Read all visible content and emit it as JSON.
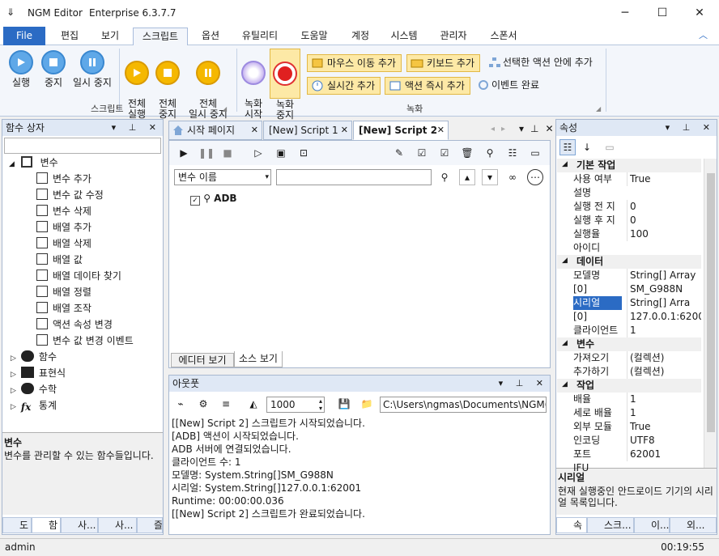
{
  "window": {
    "title": "NGM Editor",
    "edition": "Enterprise 6.3.7.7"
  },
  "menu": {
    "file": "File",
    "tabs": [
      "편집",
      "보기",
      "스크립트",
      "옵션",
      "유틸리티",
      "도움말",
      "계정",
      "시스템",
      "관리자",
      "스폰서"
    ],
    "active_tab": "스크립트"
  },
  "ribbon": {
    "script_group": {
      "label": "스크립트",
      "buttons": [
        {
          "label": "실행",
          "icon": "play-icon"
        },
        {
          "label": "중지",
          "icon": "stop-icon"
        },
        {
          "label": "일시 중지",
          "icon": "pause-icon"
        },
        {
          "label": "전체\n실행",
          "icon": "play-all-icon"
        },
        {
          "label": "전체\n중지",
          "icon": "stop-all-icon"
        },
        {
          "label": "전체\n일시 중지",
          "icon": "pause-all-icon"
        }
      ]
    },
    "record_group": {
      "label": "녹화",
      "record_start": "녹화\n시작",
      "record_stop": "녹화\n중지",
      "mouse_move": "마우스 이동 추가",
      "keyboard": "키보드 추가",
      "in_selected": "선택한 액션 안에 추가",
      "realtime": "실시간 추가",
      "action_now": "액션 즉시 추가",
      "event_done": "이벤트 완료"
    }
  },
  "function_box": {
    "title": "함수 상자",
    "search_placeholder": "",
    "tree": {
      "variables": "변수",
      "var_items": [
        "변수 추가",
        "변수 값 수정",
        "변수 삭제",
        "배열 추가",
        "배열 삭제",
        "배열 값",
        "배열 데이타 찾기",
        "배열 정렬",
        "배열 조작",
        "액션 속성 변경",
        "변수 값 변경 이벤트"
      ],
      "groups": [
        "함수",
        "표현식",
        "수학",
        "통계"
      ]
    },
    "desc_title": "변수",
    "desc_text": "변수를 관리할 수 있는 함수들입니다.",
    "bottom_tabs": [
      "도",
      "함",
      "사...",
      "사...",
      "즐"
    ]
  },
  "editor": {
    "tabs": [
      "시작 페이지",
      "[New] Script 1",
      "[New] Script 2"
    ],
    "active_tab": "[New] Script 2",
    "var_select": "변수 이름",
    "var_input": "",
    "node_label": "ADB",
    "view_tabs": [
      "에디터 보기",
      "소스 보기"
    ]
  },
  "output": {
    "title": "아웃풋",
    "count": "1000",
    "path": "C:\\Users\\ngmas\\Documents\\NGM6\\",
    "lines": [
      "[[New] Script 2] 스크립트가 시작되었습니다.",
      "[ADB] 액션이 시작되었습니다.",
      "ADB 서버에 연결되었습니다.",
      "클라이언트 수: 1",
      "모델명: System.String[]SM_G988N",
      "시리얼: System.String[]127.0.0.1:62001",
      "Runtime: 00:00:00.036",
      "[[New] Script 2] 스크립트가 완료되었습니다."
    ]
  },
  "properties": {
    "title": "속성",
    "categories": {
      "basic": "기본 작업",
      "data": "데이터",
      "vars": "변수",
      "work": "작업"
    },
    "basic_rows": [
      {
        "k": "사용 여부",
        "v": "True"
      },
      {
        "k": "설명",
        "v": ""
      },
      {
        "k": "실행 전 지",
        "v": "0"
      },
      {
        "k": "실행 후 지",
        "v": "0"
      },
      {
        "k": "실행율",
        "v": "100"
      },
      {
        "k": "아이디",
        "v": ""
      }
    ],
    "data_rows": [
      {
        "k": "모델명",
        "v": "String[] Array"
      },
      {
        "k": "[0]",
        "v": "SM_G988N"
      },
      {
        "k": "시리얼",
        "v": "String[] Arra"
      },
      {
        "k": "[0]",
        "v": "127.0.0.1:62001"
      },
      {
        "k": "클라이언트",
        "v": "1"
      }
    ],
    "var_rows": [
      {
        "k": "가져오기",
        "v": "(컬렉션)"
      },
      {
        "k": "추가하기",
        "v": "(컬렉션)"
      }
    ],
    "work_rows": [
      {
        "k": "배율",
        "v": "1"
      },
      {
        "k": "세로 배율",
        "v": "1"
      },
      {
        "k": "외부 모듈",
        "v": "True"
      },
      {
        "k": "인코딩",
        "v": "UTF8"
      },
      {
        "k": "포트",
        "v": "62001"
      },
      {
        "k": "IFU",
        "v": ""
      }
    ],
    "desc_title": "시리얼",
    "desc_text": "현재 실행중인 안드로이드 기기의 시리얼 목록입니다.",
    "bottom_tabs": [
      "속",
      "스크...",
      "이...",
      "외..."
    ]
  },
  "status": {
    "user": "admin",
    "time": "00:19:55"
  },
  "colors": {
    "accent": "#2b6bc4",
    "ribbon_highlight": "#fde9a6"
  }
}
